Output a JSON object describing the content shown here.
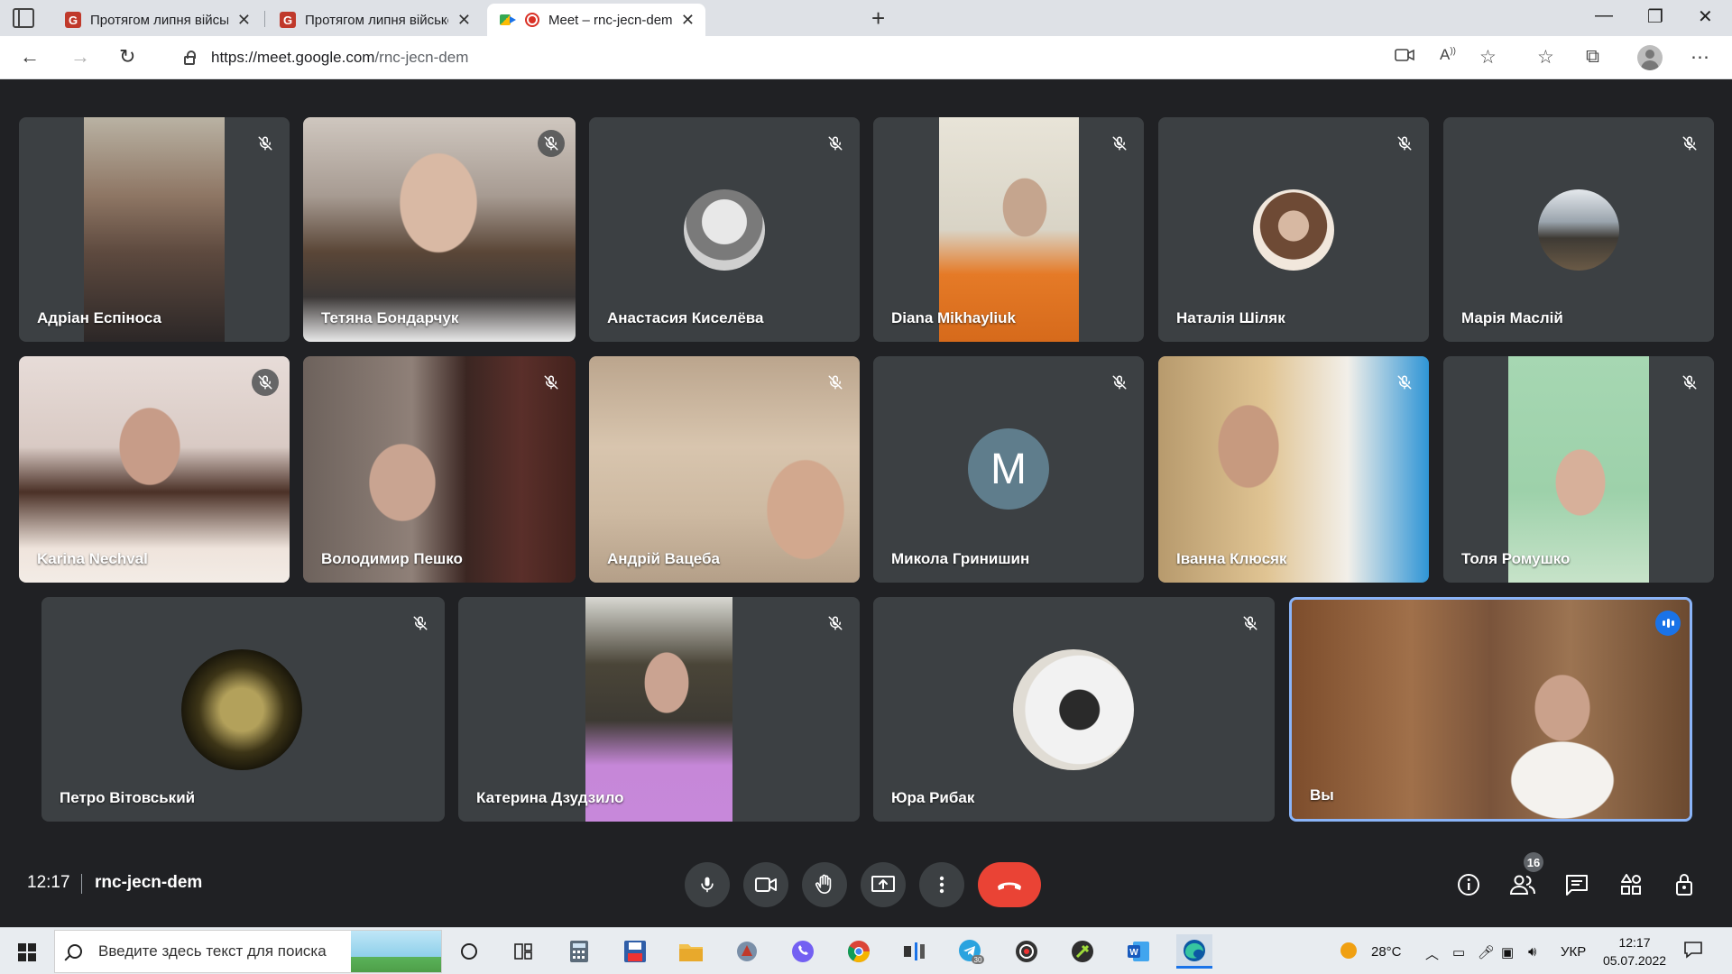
{
  "browser": {
    "tabs": [
      {
        "title": "Протягом липня військовозобо",
        "favicon": "G",
        "active": false
      },
      {
        "title": "Протягом липня військовозобо",
        "favicon": "G",
        "active": false
      },
      {
        "title": "Meet – rnc-jecn-dem",
        "favicon": "meet",
        "active": true,
        "recording": true
      }
    ],
    "url_host": "https://meet.google.com",
    "url_path": "/rnc-jecn-dem"
  },
  "meeting": {
    "time": "12:17",
    "code": "rnc-jecn-dem",
    "participant_count": "16",
    "participants": [
      {
        "name": "Адріан Еспіноса",
        "muted": true,
        "type": "video"
      },
      {
        "name": "Тетяна Бондарчук",
        "muted": true,
        "type": "video"
      },
      {
        "name": "Анастасия Киселёва",
        "muted": true,
        "type": "avatar"
      },
      {
        "name": "Diana Mikhayliuk",
        "muted": true,
        "type": "video"
      },
      {
        "name": "Наталія Шіляк",
        "muted": true,
        "type": "avatar"
      },
      {
        "name": "Марія Маслій",
        "muted": true,
        "type": "avatar"
      },
      {
        "name": "Karina Nechval",
        "muted": true,
        "type": "video"
      },
      {
        "name": "Володимир Пешко",
        "muted": true,
        "type": "video"
      },
      {
        "name": "Андрій Вацеба",
        "muted": true,
        "type": "video"
      },
      {
        "name": "Микола Гринишин",
        "muted": true,
        "type": "initial",
        "initial": "M"
      },
      {
        "name": "Іванна Клюсяк",
        "muted": true,
        "type": "video"
      },
      {
        "name": "Толя Ромушко",
        "muted": true,
        "type": "video"
      },
      {
        "name": "Петро Вітовський",
        "muted": true,
        "type": "avatar"
      },
      {
        "name": "Катерина Дзудзило",
        "muted": true,
        "type": "video"
      },
      {
        "name": "Юра Рибак",
        "muted": true,
        "type": "avatar"
      },
      {
        "name": "Вы",
        "muted": false,
        "type": "video",
        "self": true,
        "speaking": true
      }
    ]
  },
  "taskbar": {
    "search_placeholder": "Введите здесь текст для поиска",
    "weather": "28°C",
    "language": "УКР",
    "time": "12:17",
    "date": "05.07.2022",
    "telegram_badge": "30"
  },
  "colors": {
    "meet_bg": "#202124",
    "tile_bg": "#3c4043",
    "end_call": "#ea4335",
    "self_border": "#8ab4f8"
  }
}
